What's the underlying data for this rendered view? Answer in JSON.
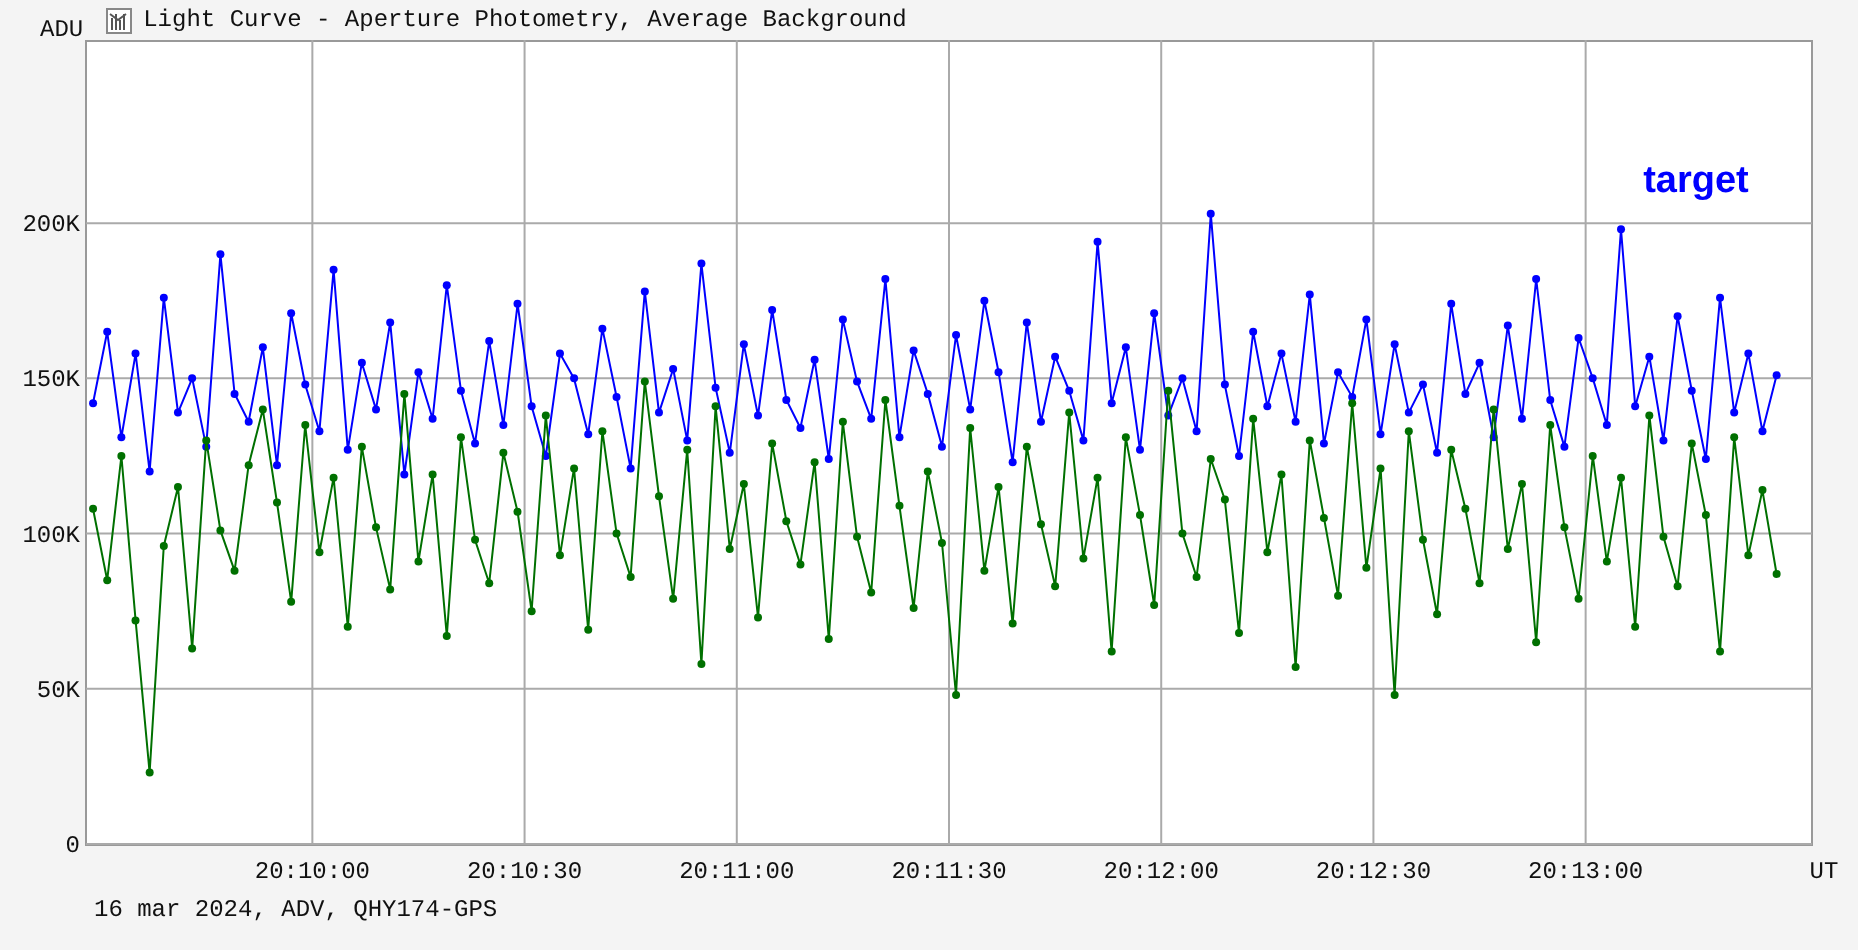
{
  "title": "Light Curve - Aperture Photometry, Average Background",
  "plot": {
    "chart_data": {
      "type": "line",
      "ylabel": "ADU",
      "xlabel": "UT",
      "grid": true,
      "xlim": [
        72568,
        72812
      ],
      "ylim": [
        0,
        259
      ],
      "x": [
        72569,
        72571,
        72573,
        72575,
        72577,
        72579,
        72581,
        72583,
        72585,
        72587,
        72589,
        72591,
        72593,
        72595,
        72597,
        72599,
        72601,
        72603,
        72605,
        72607,
        72609,
        72611,
        72613,
        72615,
        72617,
        72619,
        72621,
        72623,
        72625,
        72627,
        72629,
        72631,
        72633,
        72635,
        72637,
        72639,
        72641,
        72643,
        72645,
        72647,
        72649,
        72651,
        72653,
        72655,
        72657,
        72659,
        72661,
        72663,
        72665,
        72667,
        72669,
        72671,
        72673,
        72675,
        72677,
        72679,
        72681,
        72683,
        72685,
        72687,
        72689,
        72691,
        72693,
        72695,
        72697,
        72699,
        72701,
        72703,
        72705,
        72707,
        72709,
        72711,
        72713,
        72715,
        72717,
        72719,
        72721,
        72723,
        72725,
        72727,
        72729,
        72731,
        72733,
        72735,
        72737,
        72739,
        72741,
        72743,
        72745,
        72747,
        72749,
        72751,
        72753,
        72755,
        72757,
        72759,
        72761,
        72763,
        72765,
        72767,
        72769,
        72771,
        72773,
        72775,
        72777,
        72779,
        72781,
        72783,
        72785,
        72787,
        72789,
        72791,
        72793,
        72795,
        72797,
        72799,
        72801,
        72803,
        72805,
        72807
      ],
      "yticks": [
        {
          "value": 200,
          "label": "200K"
        },
        {
          "value": 150,
          "label": "150K"
        },
        {
          "value": 100,
          "label": "100K"
        },
        {
          "value": 50,
          "label": "50K"
        },
        {
          "value": 0,
          "label": "0"
        }
      ],
      "xticks": [
        {
          "value": 72600,
          "label": "20:10:00"
        },
        {
          "value": 72630,
          "label": "20:10:30"
        },
        {
          "value": 72660,
          "label": "20:11:00"
        },
        {
          "value": 72690,
          "label": "20:11:30"
        },
        {
          "value": 72720,
          "label": "20:12:00"
        },
        {
          "value": 72750,
          "label": "20:12:30"
        },
        {
          "value": 72780,
          "label": "20:13:00"
        }
      ],
      "series": [
        {
          "name": "target",
          "color": "#0000ff",
          "marker": "circle",
          "values": [
            142,
            165,
            131,
            158,
            120,
            176,
            139,
            150,
            128,
            190,
            145,
            136,
            160,
            122,
            171,
            148,
            133,
            185,
            127,
            155,
            140,
            168,
            119,
            152,
            137,
            180,
            146,
            129,
            162,
            135,
            174,
            141,
            125,
            158,
            150,
            132,
            166,
            144,
            121,
            178,
            139,
            153,
            130,
            187,
            147,
            126,
            161,
            138,
            172,
            143,
            134,
            156,
            124,
            169,
            149,
            137,
            182,
            131,
            159,
            145,
            128,
            164,
            140,
            175,
            152,
            123,
            168,
            136,
            157,
            146,
            130,
            194,
            142,
            160,
            127,
            171,
            138,
            150,
            133,
            203,
            148,
            125,
            165,
            141,
            158,
            136,
            177,
            129,
            152,
            144,
            169,
            132,
            161,
            139,
            148,
            126,
            174,
            145,
            155,
            131,
            167,
            137,
            182,
            143,
            128,
            163,
            150,
            135,
            198,
            141,
            157,
            130,
            170,
            146,
            124,
            176,
            139,
            158,
            133,
            151
          ]
        },
        {
          "color": "#007000",
          "marker": "circle",
          "values": [
            108,
            85,
            125,
            72,
            23,
            96,
            115,
            63,
            130,
            101,
            88,
            122,
            140,
            110,
            78,
            135,
            94,
            118,
            70,
            128,
            102,
            82,
            145,
            91,
            119,
            67,
            131,
            98,
            84,
            126,
            107,
            75,
            138,
            93,
            121,
            69,
            133,
            100,
            86,
            149,
            112,
            79,
            127,
            58,
            141,
            95,
            116,
            73,
            129,
            104,
            90,
            123,
            66,
            136,
            99,
            81,
            143,
            109,
            76,
            120,
            97,
            48,
            134,
            88,
            115,
            71,
            128,
            103,
            83,
            139,
            92,
            118,
            62,
            131,
            106,
            77,
            146,
            100,
            86,
            124,
            111,
            68,
            137,
            94,
            119,
            57,
            130,
            105,
            80,
            142,
            89,
            121,
            48,
            133,
            98,
            74,
            127,
            108,
            84,
            140,
            95,
            116,
            65,
            135,
            102,
            79,
            125,
            91,
            118,
            70,
            138,
            99,
            83,
            129,
            106,
            62,
            131,
            93,
            114,
            87
          ]
        }
      ]
    }
  },
  "footer": "16 mar 2024, ADV, QHY174-GPS"
}
